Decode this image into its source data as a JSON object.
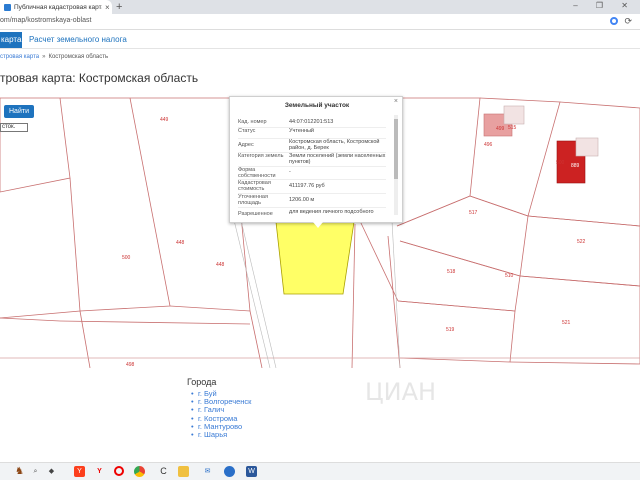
{
  "browser": {
    "tab_title": "Публичная кадастровая карта",
    "tab_close": "×",
    "new_tab": "+",
    "window_controls": "– ❐ ✕",
    "url": "om/map/kostromskaya-oblast",
    "reload": "⟳"
  },
  "site_nav": {
    "map_label": "карта",
    "calc_label": "Расчет земельного налога"
  },
  "breadcrumb": {
    "first": "стровая карта",
    "sep": "»",
    "current": "Костромская область"
  },
  "page_title": "тровая карта: Костромская область",
  "controls": {
    "find_button": "Найти",
    "region_select": "сток."
  },
  "map": {
    "parcel_numbers": [
      "449",
      "448",
      "500",
      "448",
      "498",
      "517",
      "518",
      "510",
      "519",
      "522",
      "521",
      "496",
      "499",
      "500",
      "515",
      "889"
    ],
    "colors": {
      "selected_parcel": "#ffff66",
      "boundary": "#c87070",
      "building_red": "#cc2222",
      "building_pink": "#e8a0a0"
    }
  },
  "popup": {
    "title": "Земельный участок",
    "close": "×",
    "rows": [
      {
        "label": "Кад. номер",
        "value": "44:07:012201:513"
      },
      {
        "label": "Статус",
        "value": "Учтенный"
      },
      {
        "label": "Адрес",
        "value": "Костромская область, Костромской район, д. Берек"
      },
      {
        "label": "Категория земель",
        "value": "Земли поселений (земли населенных пунктов)"
      },
      {
        "label": "Форма собственности",
        "value": "-"
      },
      {
        "label": "Кадастровая стоимость",
        "value": "411197.76 руб"
      },
      {
        "label": "Уточненная площадь",
        "value": "1206.00 м"
      },
      {
        "label": "Разрешенное",
        "value": "для ведения личного подсобного"
      }
    ]
  },
  "cities": {
    "heading": "Города",
    "items": [
      "г. Буй",
      "г. Волгореченск",
      "г. Галич",
      "г. Кострома",
      "г. Мантурово",
      "г. Шарья"
    ]
  },
  "watermark": "ЦИАН",
  "taskbar": {
    "icons": [
      "moose-icon",
      "search-icon",
      "cat-icon",
      "yandex-browser-icon",
      "opera-icon",
      "chrome-icon",
      "c-icon",
      "files-icon",
      "mail-icon",
      "chat-icon",
      "word-icon"
    ]
  }
}
